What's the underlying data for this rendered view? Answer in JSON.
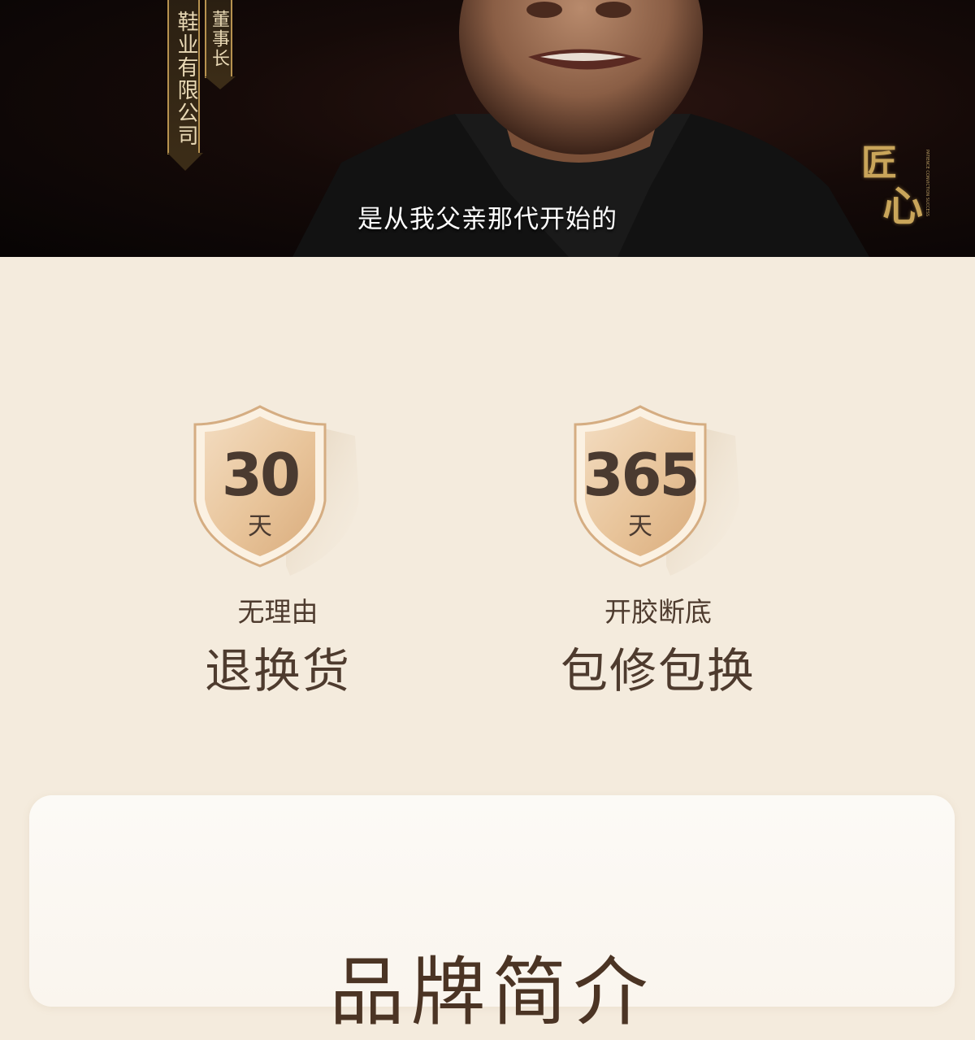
{
  "video": {
    "ribbon_company": "鞋业有限公司",
    "ribbon_title": "董事长",
    "subtitle": "是从我父亲那代开始的",
    "logo_chars": [
      "匠",
      "心"
    ],
    "logo_tagline": "PATIENCE CONVICTION SUCCESS"
  },
  "guarantees": [
    {
      "number": "30",
      "unit": "天",
      "line1": "无理由",
      "line2": "退换货"
    },
    {
      "number": "365",
      "unit": "天",
      "line1": "开胶断底",
      "line2": "包修包换"
    }
  ],
  "brand": {
    "heading": "品牌简介"
  },
  "colors": {
    "page_bg": "#f4ebdd",
    "text_brown": "#4e3b2e",
    "gold": "#c9a55a",
    "shield_fill": "#e8c49a"
  }
}
